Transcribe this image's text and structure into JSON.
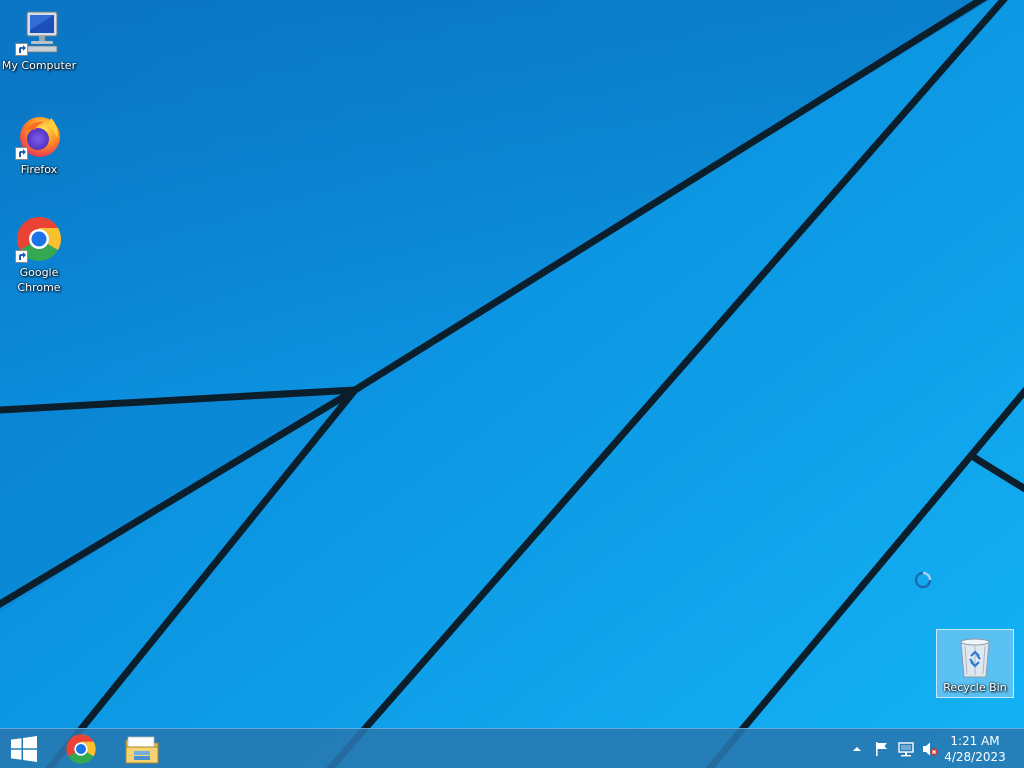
{
  "desktop": {
    "icons": [
      {
        "label": "My Computer",
        "icon": "computer-icon"
      },
      {
        "label": "Firefox",
        "icon": "firefox-icon"
      },
      {
        "label": "Google Chrome",
        "icon": "chrome-icon"
      }
    ],
    "recycle_bin": {
      "label": "Recycle Bin",
      "icon": "recycle-bin-icon",
      "selected": true
    }
  },
  "taskbar": {
    "start": {
      "icon": "windows-logo-icon"
    },
    "pinned": [
      {
        "icon": "chrome-icon"
      },
      {
        "icon": "file-explorer-icon"
      }
    ],
    "tray": {
      "items": [
        "show-hidden-icons-chevron-icon",
        "action-center-flag-icon",
        "network-icon",
        "volume-muted-icon"
      ]
    },
    "clock": {
      "time": "1:21 AM",
      "date": "4/28/2023"
    }
  },
  "colors": {
    "wallpaper_blue": "#0b8fe0",
    "wallpaper_line": "#0b1e2c",
    "taskbar": "#2878af"
  }
}
